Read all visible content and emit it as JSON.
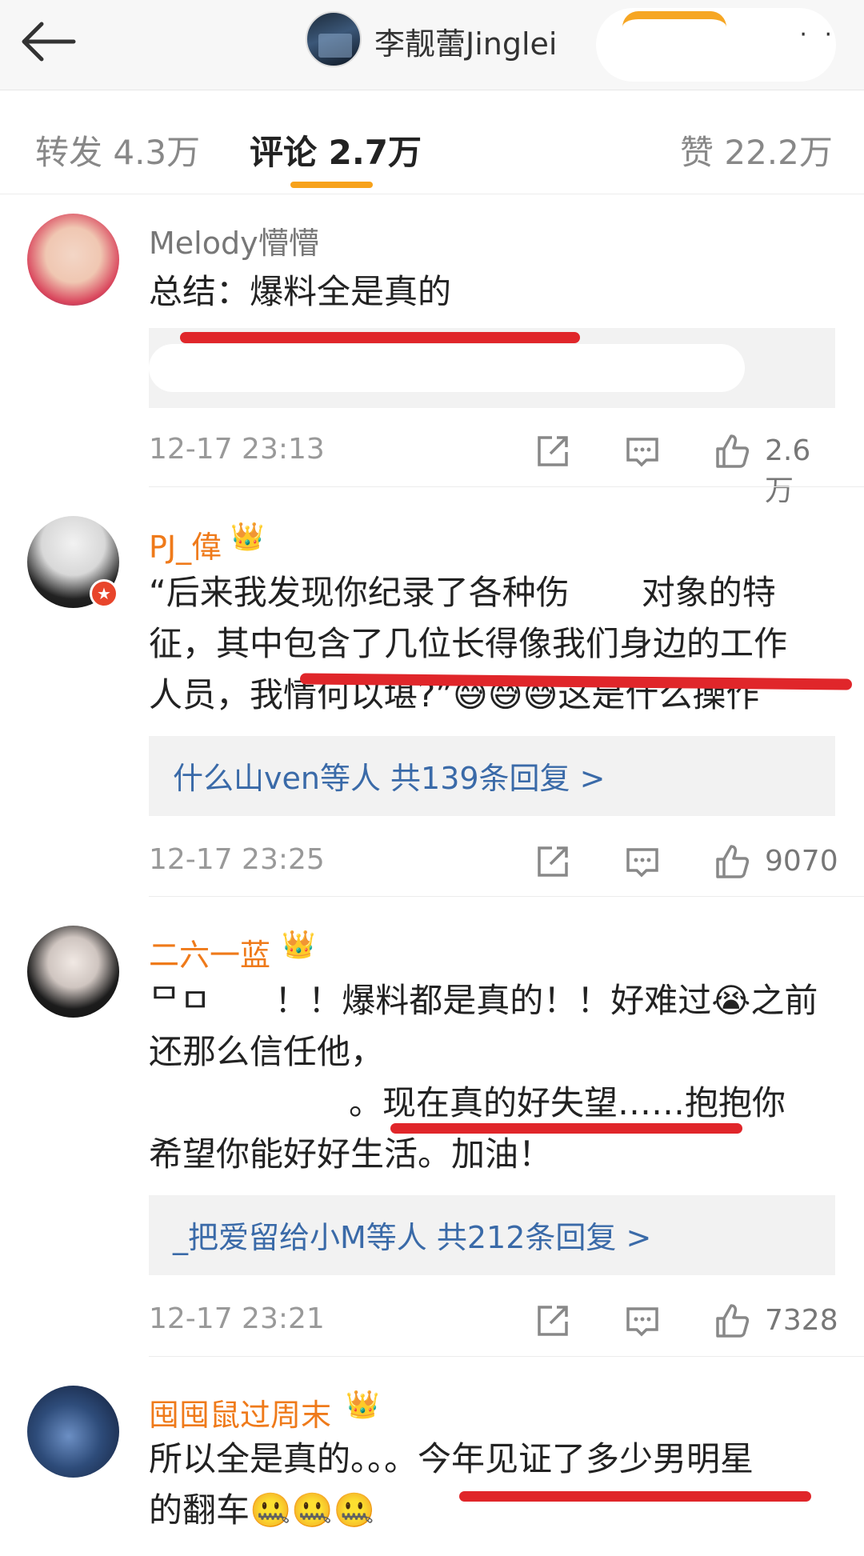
{
  "header": {
    "title": "李靓蕾Jinglei",
    "more": "· ·"
  },
  "tabs": {
    "repost": "转发 4.3万",
    "comments": "评论 2.7万",
    "likes": "赞 22.2万"
  },
  "comments": [
    {
      "user": "Melody懵懵",
      "text": "总结：爆料全是真的",
      "time": "12-17 23:13",
      "likes": "2.6万"
    },
    {
      "user": "PJ_偉",
      "badge": "👑",
      "text_line1": "“后来我发现你纪录了各种伤",
      "text_line1b": "对象的特",
      "text_line2": "征，其中包含了几位长得像我们身边的工作",
      "text_line3": "人员，我情何以堪?”😅😅😅这是什么操作",
      "reply_summary": "什么山ven等人  共139条回复 >",
      "time": "12-17 23:25",
      "likes": "9070"
    },
    {
      "user": "二六一蓝",
      "badge": "👑",
      "text_line1": "！！爆料都是真的！！好难过😭之前",
      "text_line1_prefix": "ᄆㅁ",
      "text_line2": "还那么信任他，",
      "text_line3": "。现在真的好失望……抱抱你",
      "text_line4": "希望你能好好生活。加油！",
      "reply_summary": "_把爱留给小M等人  共212条回复 >",
      "time": "12-17 23:21",
      "likes": "7328"
    },
    {
      "user": "囤囤鼠过周末",
      "badge": "👑",
      "text_line1": "所以全是真的。。。今年见证了多少男明星",
      "text_line2": "的翻车🤐🤐🤐"
    }
  ]
}
